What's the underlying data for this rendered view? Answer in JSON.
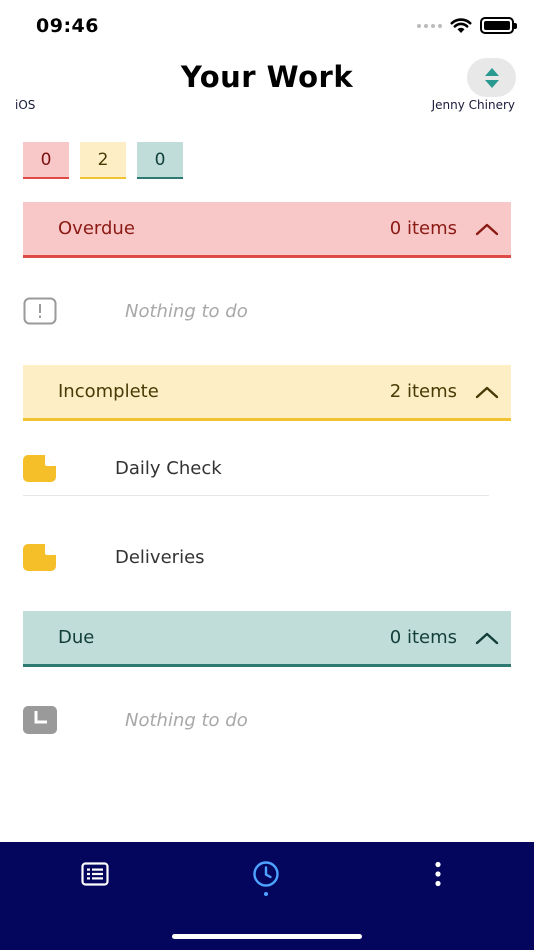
{
  "status_bar": {
    "time": "09:46"
  },
  "header": {
    "title": "Your Work",
    "platform": "iOS",
    "user": "Jenny Chinery",
    "sort_icon": "sort-updown-icon"
  },
  "counts": {
    "overdue": "0",
    "incomplete": "2",
    "due": "0"
  },
  "sections": {
    "overdue": {
      "title": "Overdue",
      "count_label": "0 items",
      "empty_text": "Nothing to do",
      "icon": "exclamation-icon"
    },
    "incomplete": {
      "title": "Incomplete",
      "count_label": "2 items",
      "items": [
        {
          "label": "Daily Check",
          "icon": "note-icon"
        },
        {
          "label": "Deliveries",
          "icon": "note-icon"
        }
      ]
    },
    "due": {
      "title": "Due",
      "count_label": "0 items",
      "empty_text": "Nothing to do",
      "icon": "clock-square-icon"
    }
  },
  "nav": {
    "items": [
      "list-icon",
      "clock-icon",
      "more-vertical-icon"
    ],
    "active": "clock-icon"
  },
  "colors": {
    "overdue": "#e04a44",
    "incomplete": "#f1c232",
    "due": "#2e7a73",
    "nav_bg": "#04055c",
    "accent": "#4da3ff"
  }
}
